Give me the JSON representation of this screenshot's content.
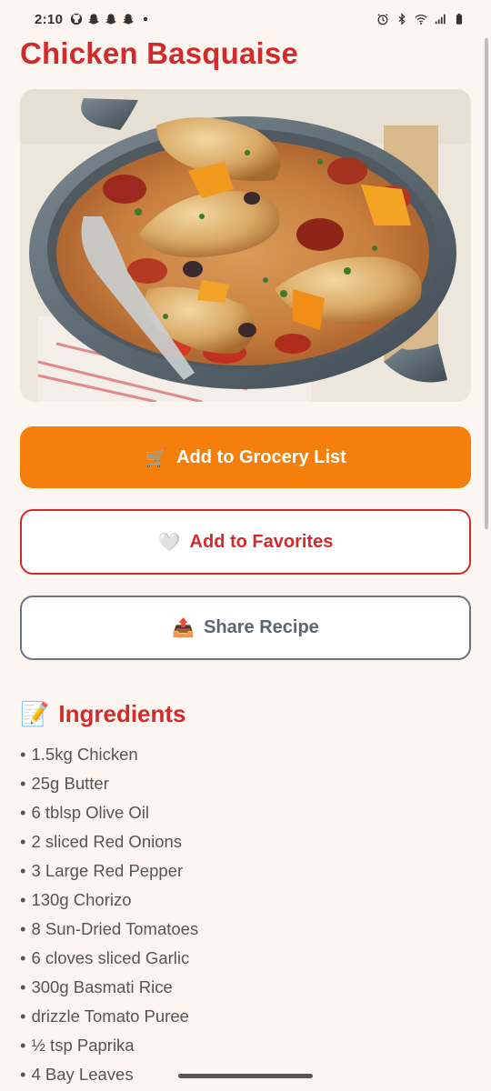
{
  "status_bar": {
    "time": "2:10",
    "notification_icons": [
      "github-icon",
      "snapchat-icon",
      "snapchat-icon",
      "snapchat-icon",
      "dot-icon"
    ],
    "system_icons": [
      "alarm-icon",
      "bluetooth-icon",
      "wifi-icon",
      "signal-icon",
      "battery-icon"
    ]
  },
  "recipe": {
    "title": "Chicken Basquaise",
    "image_alt": "Chicken Basquaise in a grey casserole pan"
  },
  "actions": {
    "grocery": {
      "icon": "🛒",
      "label": "Add to Grocery List",
      "color": "#f57f0a"
    },
    "favorites": {
      "icon": "🤍",
      "label": "Add to Favorites",
      "color": "#d22b2b"
    },
    "share": {
      "icon": "📤",
      "label": "Share Recipe",
      "color": "#6b7580"
    }
  },
  "ingredients": {
    "icon": "📝",
    "heading": "Ingredients",
    "bullet": "•",
    "items": [
      "1.5kg Chicken",
      "25g Butter",
      "6 tblsp Olive Oil",
      "2 sliced Red Onions",
      "3 Large Red Pepper",
      "130g Chorizo",
      "8 Sun-Dried Tomatoes",
      "6 cloves sliced Garlic",
      "300g Basmati Rice",
      "drizzle Tomato Puree",
      "½ tsp Paprika",
      "4 Bay Leaves"
    ]
  },
  "colors": {
    "background": "#fdf6f0",
    "accent_red": "#d22b2b",
    "accent_orange": "#f57f0a"
  }
}
